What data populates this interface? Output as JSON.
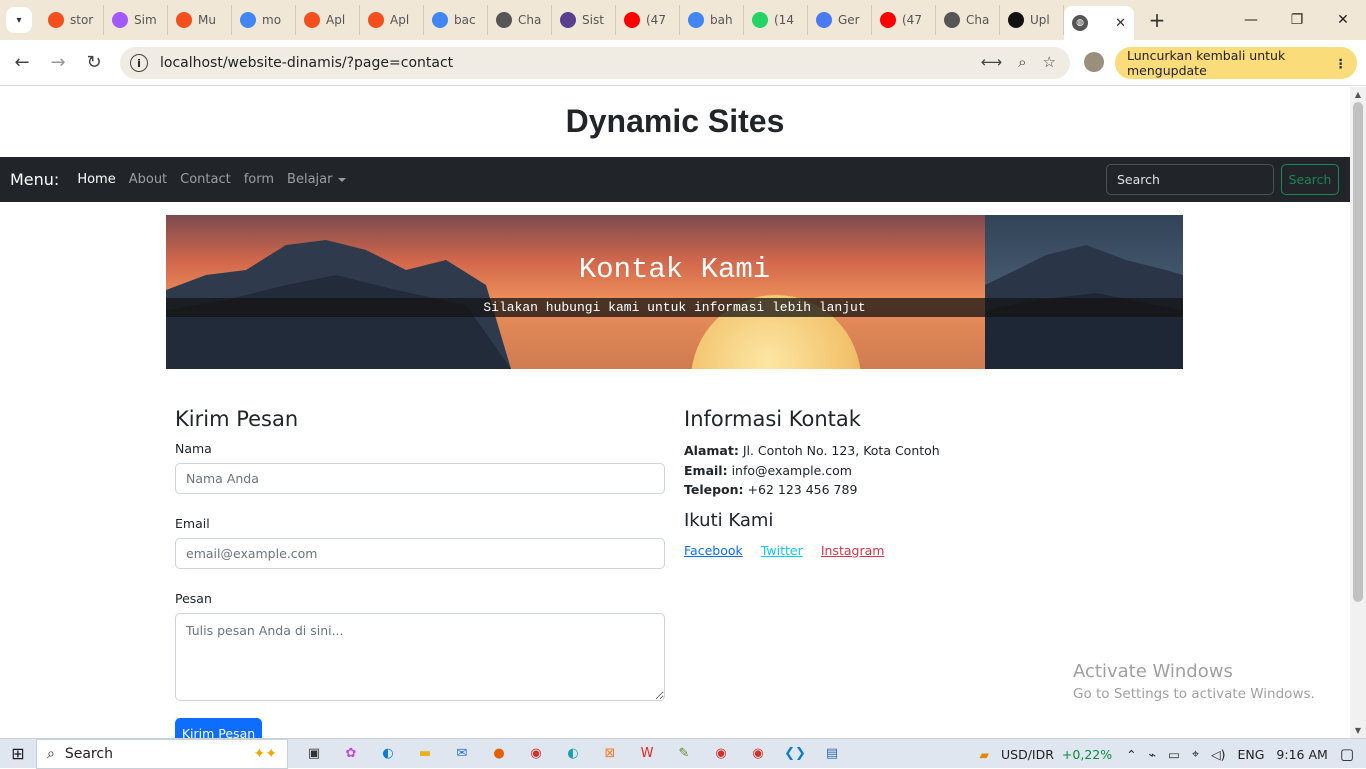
{
  "browser": {
    "tabs": [
      {
        "label": "stor",
        "icon": "figma-icon",
        "color": "#f24e1e"
      },
      {
        "label": "Sim",
        "icon": "figma-alt-icon",
        "color": "#a259ff"
      },
      {
        "label": "Mu",
        "icon": "figma-icon",
        "color": "#f24e1e"
      },
      {
        "label": "mo",
        "icon": "google-icon",
        "color": "#4285f4"
      },
      {
        "label": "Apl",
        "icon": "figma-icon",
        "color": "#f24e1e"
      },
      {
        "label": "Apl",
        "icon": "figma-icon",
        "color": "#f24e1e"
      },
      {
        "label": "bac",
        "icon": "google-icon",
        "color": "#4285f4"
      },
      {
        "label": "Cha",
        "icon": "chatgpt-icon",
        "color": "#555555"
      },
      {
        "label": "Sist",
        "icon": "site-icon",
        "color": "#5b3f8f"
      },
      {
        "label": "(47",
        "icon": "youtube-icon",
        "color": "#ff0000"
      },
      {
        "label": "bah",
        "icon": "google-icon",
        "color": "#4285f4"
      },
      {
        "label": "(14",
        "icon": "whatsapp-icon",
        "color": "#25d366"
      },
      {
        "label": "Ger",
        "icon": "gemini-icon",
        "color": "#4a7bf0"
      },
      {
        "label": "(47",
        "icon": "youtube-icon",
        "color": "#ff0000"
      },
      {
        "label": "Cha",
        "icon": "chatgpt-icon",
        "color": "#555555"
      },
      {
        "label": "Upl",
        "icon": "github-icon",
        "color": "#111111"
      }
    ],
    "active_tab_icon": "globe-icon",
    "url": "localhost/website-dinamis/?page=contact",
    "update_label": "Luncurkan kembali untuk mengupdate"
  },
  "site": {
    "title": "Dynamic Sites",
    "nav": {
      "brand": "Menu:",
      "links": [
        "Home",
        "About",
        "Contact",
        "form",
        "Belajar"
      ],
      "search_placeholder": "Search",
      "search_button": "Search"
    },
    "hero": {
      "title": "Kontak Kami",
      "subtitle": "Silakan hubungi kami untuk informasi lebih lanjut"
    },
    "form": {
      "heading": "Kirim Pesan",
      "name_label": "Nama",
      "name_placeholder": "Nama Anda",
      "email_label": "Email",
      "email_placeholder": "email@example.com",
      "message_label": "Pesan",
      "message_placeholder": "Tulis pesan Anda di sini...",
      "submit_label": "Kirim Pesan"
    },
    "contact": {
      "heading": "Informasi Kontak",
      "address_label": "Alamat:",
      "address_value": "Jl. Contoh No. 123, Kota Contoh",
      "email_label": "Email:",
      "email_value": "info@example.com",
      "phone_label": "Telepon:",
      "phone_value": "+62 123 456 789",
      "follow_heading": "Ikuti Kami",
      "social": [
        "Facebook",
        "Twitter",
        "Instagram"
      ]
    }
  },
  "watermark": {
    "line1": "Activate Windows",
    "line2": "Go to Settings to activate Windows."
  },
  "taskbar": {
    "search_label": "Search",
    "ticker": "USD/IDR",
    "ticker_change": "+0,22%",
    "language": "ENG",
    "time": "9:16 AM"
  }
}
